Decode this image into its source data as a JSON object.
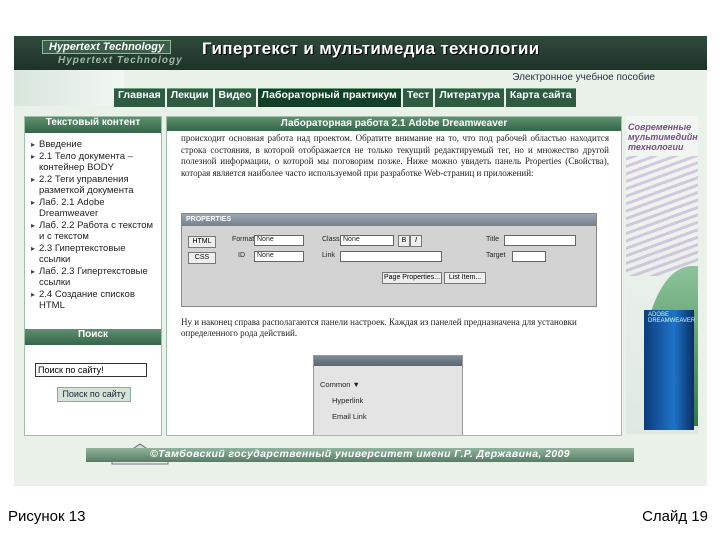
{
  "header": {
    "logo_line1": "Hypertext Technology",
    "logo_line2": "Hypertext Technology",
    "title": "Гипертекст и мультимедиа технологии",
    "subtitle": "Электронное учебное пособие"
  },
  "nav": {
    "items": [
      {
        "label": "Главная"
      },
      {
        "label": "Лекции"
      },
      {
        "label": "Видео"
      },
      {
        "label": "Лабораторный практикум"
      },
      {
        "label": "Тест"
      },
      {
        "label": "Литература"
      },
      {
        "label": "Карта сайта"
      }
    ],
    "active_index": 3
  },
  "sidebar": {
    "heading": "Текстовый контент",
    "items": [
      {
        "label": "Введение"
      },
      {
        "label": "2.1 Тело документа – контейнер BODY"
      },
      {
        "label": "2.2 Теги управления разметкой документа"
      },
      {
        "label": "Лаб. 2.1 Adobe Dreamweaver"
      },
      {
        "label": "Лаб. 2.2 Работа с текстом и с текстом"
      },
      {
        "label": "2.3 Гипертекстовые ссылки"
      },
      {
        "label": "Лаб. 2.3 Гипертекстовые ссылки"
      },
      {
        "label": "2.4 Создание списков HTML"
      }
    ],
    "search_heading": "Поиск",
    "search_value": "Поиск по сайту!",
    "search_button": "Поиск по сайту"
  },
  "main": {
    "heading": "Лабораторная работа 2.1 Adobe Dreamweaver",
    "paragraph1": "происходит основная работа над проектом. Обратите внимание на то, что под рабочей областью находится строка состояния, в которой отображается не только текущий редактируемый тег, но и множество другой полезной информации, о которой мы поговорим позже. Ниже можно увидеть панель Properties (Свойства), которая является наиболее часто используемой при разработке Web-страниц и приложений:",
    "paragraph2": "Ну и наконец справа располагаются панели настроек. Каждая из панелей предназначена для установки определенного рода действий.",
    "properties_panel": {
      "title": "PROPERTIES",
      "html_label": "HTML",
      "css_label": "CSS",
      "format_label": "Format",
      "format_value": "None",
      "class_label": "Class",
      "class_value": "None",
      "bold": "B",
      "italic": "I",
      "title_label": "Title",
      "id_label": "ID",
      "id_value": "None",
      "link_label": "Link",
      "target_label": "Target",
      "page_props": "Page Properties...",
      "list_item": "List Item..."
    },
    "mini_panel": {
      "row1": "Common ▼",
      "row2": "Hyperlink",
      "row3": "Email Link"
    }
  },
  "right_deco": {
    "text": "Современные мультимедийные технологии",
    "box_text": "ADOBE DREAMWEAVER"
  },
  "footer": {
    "text": "©Тамбовский государственный университет имени Г.Р. Державина, 2009"
  },
  "captions": {
    "left": "Рисунок 13",
    "right": "Слайд 19"
  }
}
